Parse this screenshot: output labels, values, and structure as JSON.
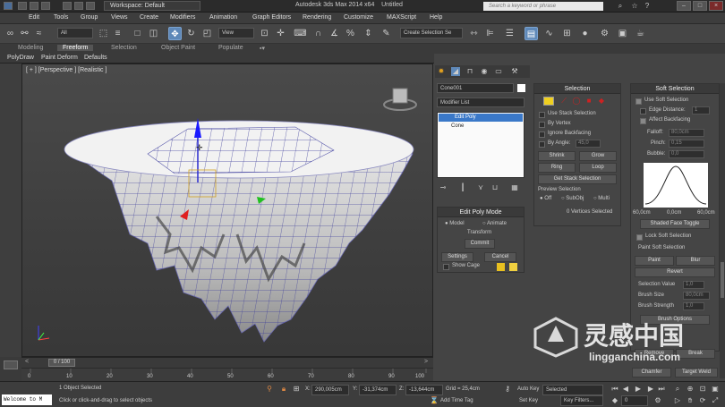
{
  "titlebar": {
    "workspace": "Workspace: Default",
    "app_title": "Autodesk 3ds Max 2014 x64",
    "doc_title": "Untitled",
    "search_placeholder": "Search a keyword or phrase"
  },
  "menu": [
    "Edit",
    "Tools",
    "Group",
    "Views",
    "Create",
    "Modifiers",
    "Animation",
    "Graph Editors",
    "Rendering",
    "Customize",
    "MAXScript",
    "Help"
  ],
  "toolbar": {
    "filter_value": "All",
    "coord_value": "View",
    "selection_set_placeholder": "Create Selection Se"
  },
  "ribbon": {
    "tabs": [
      "Modeling",
      "Freeform",
      "Selection",
      "Object Paint",
      "Populate"
    ],
    "selected_tab": "Freeform",
    "sub_tabs": [
      "PolyDraw",
      "Paint Deform",
      "Defaults"
    ]
  },
  "viewport": {
    "label": "[ + ] [Perspective ] [Realistic ]"
  },
  "command_panel": {
    "object_name": "Cone001",
    "modifier_list_label": "Modifier List",
    "stack_items": [
      "Edit Poly",
      "Cone"
    ],
    "edit_poly_mode": {
      "title": "Edit Poly Mode",
      "model_label": "Model",
      "animate_label": "Animate",
      "transform_label": "Transform",
      "commit_label": "Commit",
      "settings_label": "Settings",
      "cancel_label": "Cancel",
      "show_cage_label": "Show Cage"
    }
  },
  "selection_panel": {
    "title": "Selection",
    "use_stack_selection": "Use Stack Selection",
    "by_vertex": "By Vertex",
    "ignore_backfacing": "Ignore Backfacing",
    "by_angle": "By Angle:",
    "by_angle_value": "45,0",
    "shrink": "Shrink",
    "grow": "Grow",
    "ring": "Ring",
    "loop": "Loop",
    "get_stack_selection": "Get Stack Selection",
    "preview_selection": "Preview Selection",
    "preview_off": "Off",
    "preview_subobj": "SubObj",
    "preview_multi": "Multi",
    "status": "0 Vertices Selected"
  },
  "soft_selection_panel": {
    "title": "Soft Selection",
    "use_soft_selection": "Use Soft Selection",
    "edge_distance": "Edge Distance:",
    "edge_distance_value": "1",
    "affect_backfacing": "Affect Backfacing",
    "falloff_label": "Falloff:",
    "falloff_value": "80,0cm",
    "pinch_label": "Pinch:",
    "pinch_value": "0,15",
    "bubble_label": "Bubble:",
    "bubble_value": "0,0",
    "curve_labels": [
      "60,0cm",
      "0,0cm",
      "60,0cm"
    ],
    "shaded_face_toggle": "Shaded Face Toggle",
    "lock_soft_selection": "Lock Soft Selection",
    "paint_soft_selection": "Paint Soft Selection",
    "paint": "Paint",
    "blur": "Blur",
    "revert": "Revert",
    "selection_value_label": "Selection Value",
    "selection_value": "1,0",
    "brush_size_label": "Brush Size",
    "brush_size": "80,0cm",
    "brush_strength_label": "Brush Strength",
    "brush_strength": "1,0",
    "brush_options": "Brush Options",
    "remove": "Remove",
    "break": "Break",
    "chamfer": "Chamfer",
    "target_weld": "Target Weld"
  },
  "timeline": {
    "frame_label": "0 / 100",
    "ticks": [
      "0",
      "10",
      "20",
      "30",
      "40",
      "50",
      "60",
      "70",
      "80",
      "90",
      "100"
    ]
  },
  "statusbar": {
    "maxscript": "Welcome to M",
    "selected": "1 Object Selected",
    "prompt": "Click or click-and-drag to select objects",
    "x_label": "X:",
    "x_value": "290,005cm",
    "y_label": "Y:",
    "y_value": "-31,374cm",
    "z_label": "Z:",
    "z_value": "-13,644cm",
    "grid": "Grid = 25,4cm",
    "add_time_tag": "Add Time Tag",
    "auto_key": "Auto Key",
    "auto_key_value": "Selected",
    "set_key": "Set Key",
    "key_filters": "Key Filters...",
    "frame_value": "0"
  },
  "watermark": {
    "text_cn": "灵感中国",
    "text_url": "lingganchina.com"
  },
  "colors": {
    "accent": "#5e88b8",
    "viewport_bg": "#404040",
    "panel_bg": "#454545",
    "mesh_wire": "#2a2aa0",
    "yellow_swatch": "#e8c020"
  }
}
